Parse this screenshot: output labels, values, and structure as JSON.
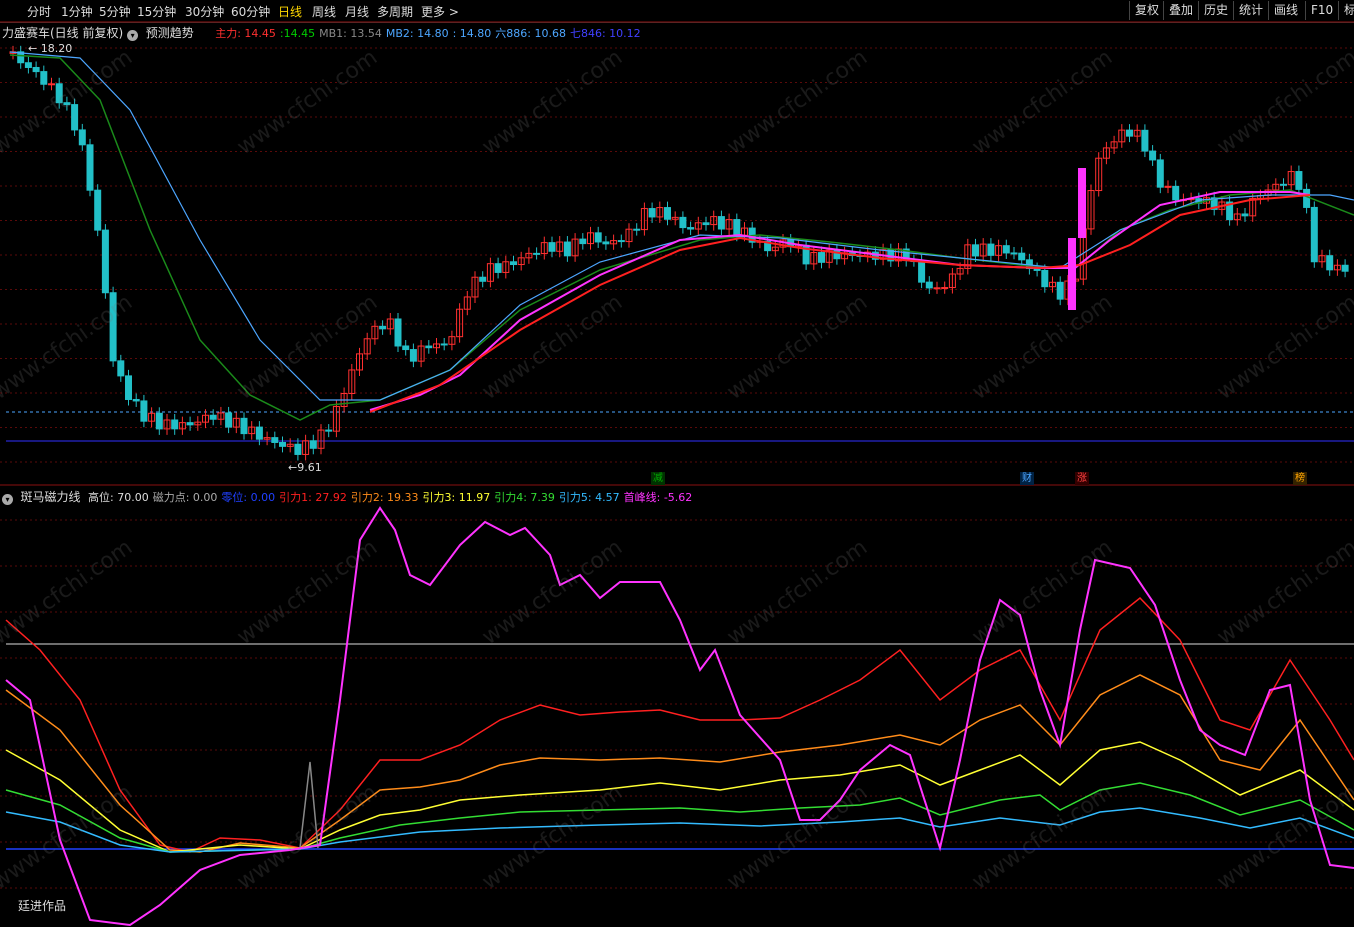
{
  "toolbar": {
    "periods": [
      "分时",
      "1分钟",
      "5分钟",
      "15分钟",
      "30分钟",
      "60分钟",
      "日线",
      "周线",
      "月线",
      "多周期",
      "更多 >"
    ],
    "active_period": "日线",
    "right_buttons": [
      "复权",
      "叠加",
      "历史",
      "统计",
      "画线",
      "F10",
      "标"
    ]
  },
  "main_legend": {
    "name": "力盛赛车(日线 前复权)",
    "predict": "预测趋势",
    "items": [
      {
        "label": "主力: 14.45",
        "color": "#ff3030"
      },
      {
        "label": ":14.45",
        "color": "#00cc00"
      },
      {
        "label": "MB1: 13.54",
        "color": "#888888"
      },
      {
        "label": "MB2: 14.80",
        "color": "#4da6ff"
      },
      {
        "label": ": 14.80",
        "color": "#4da6ff"
      },
      {
        "label": "六886: 10.68",
        "color": "#4da6ff"
      },
      {
        "label": "七846: 10.12",
        "color": "#4040ff"
      }
    ],
    "high_label": "18.20",
    "low_label": "9.61"
  },
  "signals": [
    {
      "text": "减",
      "color": "#00aa00",
      "bg": "#003300"
    },
    {
      "text": "财",
      "color": "#4da6ff",
      "bg": "#002244"
    },
    {
      "text": "涨",
      "color": "#ff4040",
      "bg": "#330000"
    },
    {
      "text": "榜",
      "color": "#ffa500",
      "bg": "#332200"
    }
  ],
  "sub_legend": {
    "name": "斑马磁力线",
    "items": [
      {
        "label": "高位: 70.00",
        "color": "#dddddd"
      },
      {
        "label": "磁力点: 0.00",
        "color": "#aaaaaa"
      },
      {
        "label": "零位: 0.00",
        "color": "#2040ff"
      },
      {
        "label": "引力1: 27.92",
        "color": "#ff2020"
      },
      {
        "label": "引力2: 19.33",
        "color": "#ff8c1a"
      },
      {
        "label": "引力3: 11.97",
        "color": "#ffff33"
      },
      {
        "label": "引力4: 7.39",
        "color": "#33dd33"
      },
      {
        "label": "引力5: 4.57",
        "color": "#33bbff"
      },
      {
        "label": "首峰线: -5.62",
        "color": "#ff33ff"
      }
    ]
  },
  "author": "廷进作品",
  "watermark": "www.cfchi.com"
}
